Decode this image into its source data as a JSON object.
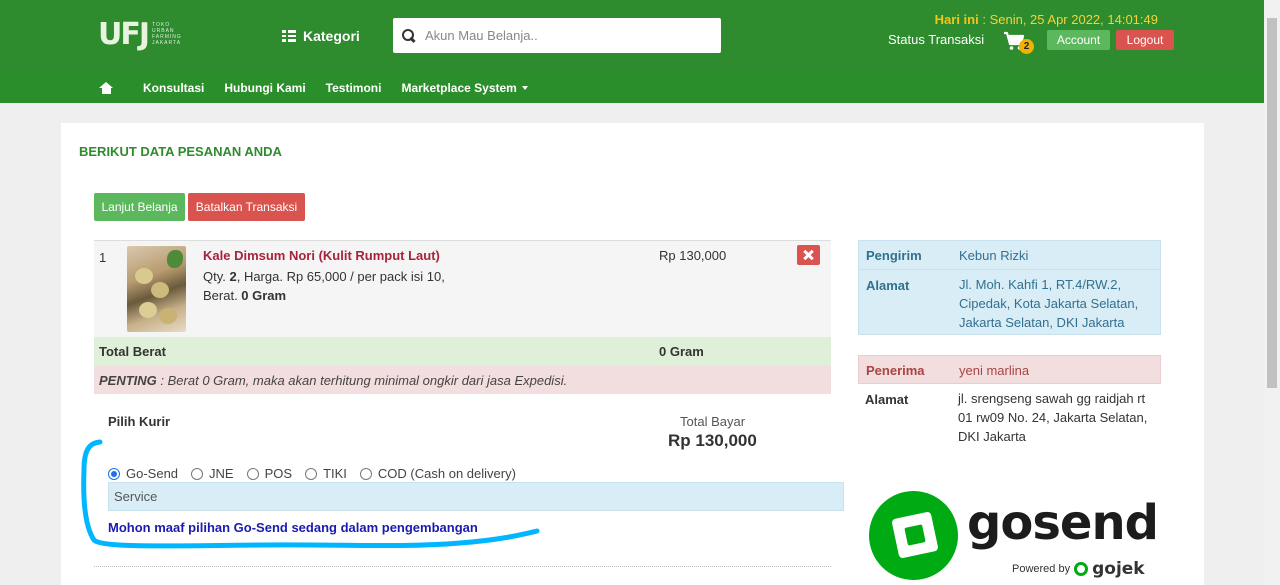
{
  "header": {
    "logo_text": "UFJ",
    "logo_sub": [
      "TOKO",
      "URBAN",
      "FARMING",
      "JAKARTA"
    ],
    "kategori_label": "Kategori",
    "search_placeholder": "Akun Mau Belanja..",
    "date_label": "Hari ini",
    "date_value": " : Senin, 25 Apr 2022, 14:01:49",
    "status_transaksi": "Status Transaksi",
    "cart_count": "2",
    "account_label": "Account",
    "logout_label": "Logout"
  },
  "nav": {
    "items": [
      "Konsultasi",
      "Hubungi Kami",
      "Testimoni",
      "Marketplace System"
    ]
  },
  "order": {
    "title": "BERIKUT DATA PESANAN ANDA",
    "lanjut_label": "Lanjut Belanja",
    "batal_label": "Batalkan Transaksi",
    "item": {
      "no": "1",
      "name": "Kale Dimsum Nori (Kulit Rumput Laut)",
      "qty_prefix": "Qty. ",
      "qty": "2",
      "price_desc": ", Harga. Rp 65,000 / per pack isi 10,",
      "weight_prefix": "Berat. ",
      "weight": "0 Gram",
      "price": "Rp 130,000"
    },
    "total_berat_label": "Total Berat",
    "total_berat_value": "0 Gram",
    "penting_label": "PENTING",
    "penting_text": " : Berat 0 Gram, maka akan terhitung minimal ongkir dari jasa Expedisi.",
    "pilih_kurir": "Pilih Kurir",
    "total_bayar_label": "Total Bayar",
    "total_bayar_value": "Rp 130,000",
    "kurir_options": [
      "Go-Send",
      "JNE",
      "POS",
      "TIKI",
      "COD (Cash on delivery)"
    ],
    "kurir_selected": "Go-Send",
    "service_label": "Service",
    "gosend_notice": "Mohon maaf pilihan Go-Send sedang dalam pengembangan"
  },
  "info": {
    "pengirim_label": "Pengirim",
    "pengirim_value": "Kebun Rizki",
    "alamat_label": "Alamat",
    "alamat_pengirim": "Jl. Moh. Kahfi 1, RT.4/RW.2, Cipedak, Kota Jakarta Selatan, Jakarta Selatan, DKI Jakarta",
    "penerima_label": "Penerima",
    "penerima_value": "yeni marlina",
    "alamat_penerima": "jl. srengseng sawah gg raidjah rt 01 rw09 No. 24, Jakarta Selatan, DKI Jakarta"
  },
  "gosend_logo": {
    "word": "gosend",
    "powered_by": "Powered by",
    "brand": "gojek"
  },
  "colors": {
    "header_green": "#2e8b2e",
    "success": "#5cb85c",
    "danger": "#d9534f",
    "info_bg": "#d9edf7",
    "danger_bg": "#f2dede",
    "success_bg": "#dff0d8",
    "gosend_green": "#00aa13",
    "annotation": "#00b7ff"
  }
}
